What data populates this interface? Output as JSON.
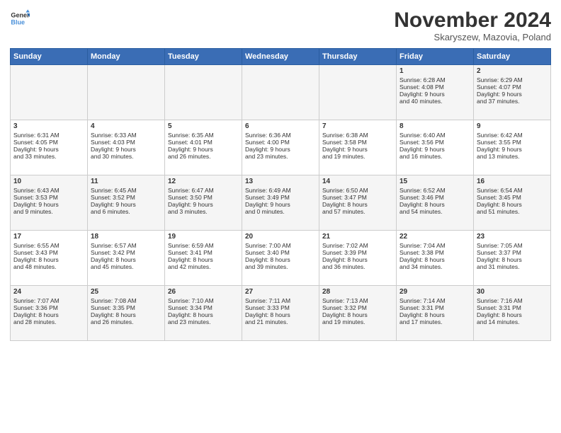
{
  "logo": {
    "line1": "General",
    "line2": "Blue"
  },
  "title": "November 2024",
  "subtitle": "Skaryszew, Mazovia, Poland",
  "days_of_week": [
    "Sunday",
    "Monday",
    "Tuesday",
    "Wednesday",
    "Thursday",
    "Friday",
    "Saturday"
  ],
  "weeks": [
    [
      {
        "day": "",
        "info": ""
      },
      {
        "day": "",
        "info": ""
      },
      {
        "day": "",
        "info": ""
      },
      {
        "day": "",
        "info": ""
      },
      {
        "day": "",
        "info": ""
      },
      {
        "day": "1",
        "info": "Sunrise: 6:28 AM\nSunset: 4:08 PM\nDaylight: 9 hours\nand 40 minutes."
      },
      {
        "day": "2",
        "info": "Sunrise: 6:29 AM\nSunset: 4:07 PM\nDaylight: 9 hours\nand 37 minutes."
      }
    ],
    [
      {
        "day": "3",
        "info": "Sunrise: 6:31 AM\nSunset: 4:05 PM\nDaylight: 9 hours\nand 33 minutes."
      },
      {
        "day": "4",
        "info": "Sunrise: 6:33 AM\nSunset: 4:03 PM\nDaylight: 9 hours\nand 30 minutes."
      },
      {
        "day": "5",
        "info": "Sunrise: 6:35 AM\nSunset: 4:01 PM\nDaylight: 9 hours\nand 26 minutes."
      },
      {
        "day": "6",
        "info": "Sunrise: 6:36 AM\nSunset: 4:00 PM\nDaylight: 9 hours\nand 23 minutes."
      },
      {
        "day": "7",
        "info": "Sunrise: 6:38 AM\nSunset: 3:58 PM\nDaylight: 9 hours\nand 19 minutes."
      },
      {
        "day": "8",
        "info": "Sunrise: 6:40 AM\nSunset: 3:56 PM\nDaylight: 9 hours\nand 16 minutes."
      },
      {
        "day": "9",
        "info": "Sunrise: 6:42 AM\nSunset: 3:55 PM\nDaylight: 9 hours\nand 13 minutes."
      }
    ],
    [
      {
        "day": "10",
        "info": "Sunrise: 6:43 AM\nSunset: 3:53 PM\nDaylight: 9 hours\nand 9 minutes."
      },
      {
        "day": "11",
        "info": "Sunrise: 6:45 AM\nSunset: 3:52 PM\nDaylight: 9 hours\nand 6 minutes."
      },
      {
        "day": "12",
        "info": "Sunrise: 6:47 AM\nSunset: 3:50 PM\nDaylight: 9 hours\nand 3 minutes."
      },
      {
        "day": "13",
        "info": "Sunrise: 6:49 AM\nSunset: 3:49 PM\nDaylight: 9 hours\nand 0 minutes."
      },
      {
        "day": "14",
        "info": "Sunrise: 6:50 AM\nSunset: 3:47 PM\nDaylight: 8 hours\nand 57 minutes."
      },
      {
        "day": "15",
        "info": "Sunrise: 6:52 AM\nSunset: 3:46 PM\nDaylight: 8 hours\nand 54 minutes."
      },
      {
        "day": "16",
        "info": "Sunrise: 6:54 AM\nSunset: 3:45 PM\nDaylight: 8 hours\nand 51 minutes."
      }
    ],
    [
      {
        "day": "17",
        "info": "Sunrise: 6:55 AM\nSunset: 3:43 PM\nDaylight: 8 hours\nand 48 minutes."
      },
      {
        "day": "18",
        "info": "Sunrise: 6:57 AM\nSunset: 3:42 PM\nDaylight: 8 hours\nand 45 minutes."
      },
      {
        "day": "19",
        "info": "Sunrise: 6:59 AM\nSunset: 3:41 PM\nDaylight: 8 hours\nand 42 minutes."
      },
      {
        "day": "20",
        "info": "Sunrise: 7:00 AM\nSunset: 3:40 PM\nDaylight: 8 hours\nand 39 minutes."
      },
      {
        "day": "21",
        "info": "Sunrise: 7:02 AM\nSunset: 3:39 PM\nDaylight: 8 hours\nand 36 minutes."
      },
      {
        "day": "22",
        "info": "Sunrise: 7:04 AM\nSunset: 3:38 PM\nDaylight: 8 hours\nand 34 minutes."
      },
      {
        "day": "23",
        "info": "Sunrise: 7:05 AM\nSunset: 3:37 PM\nDaylight: 8 hours\nand 31 minutes."
      }
    ],
    [
      {
        "day": "24",
        "info": "Sunrise: 7:07 AM\nSunset: 3:36 PM\nDaylight: 8 hours\nand 28 minutes."
      },
      {
        "day": "25",
        "info": "Sunrise: 7:08 AM\nSunset: 3:35 PM\nDaylight: 8 hours\nand 26 minutes."
      },
      {
        "day": "26",
        "info": "Sunrise: 7:10 AM\nSunset: 3:34 PM\nDaylight: 8 hours\nand 23 minutes."
      },
      {
        "day": "27",
        "info": "Sunrise: 7:11 AM\nSunset: 3:33 PM\nDaylight: 8 hours\nand 21 minutes."
      },
      {
        "day": "28",
        "info": "Sunrise: 7:13 AM\nSunset: 3:32 PM\nDaylight: 8 hours\nand 19 minutes."
      },
      {
        "day": "29",
        "info": "Sunrise: 7:14 AM\nSunset: 3:31 PM\nDaylight: 8 hours\nand 17 minutes."
      },
      {
        "day": "30",
        "info": "Sunrise: 7:16 AM\nSunset: 3:31 PM\nDaylight: 8 hours\nand 14 minutes."
      }
    ]
  ]
}
